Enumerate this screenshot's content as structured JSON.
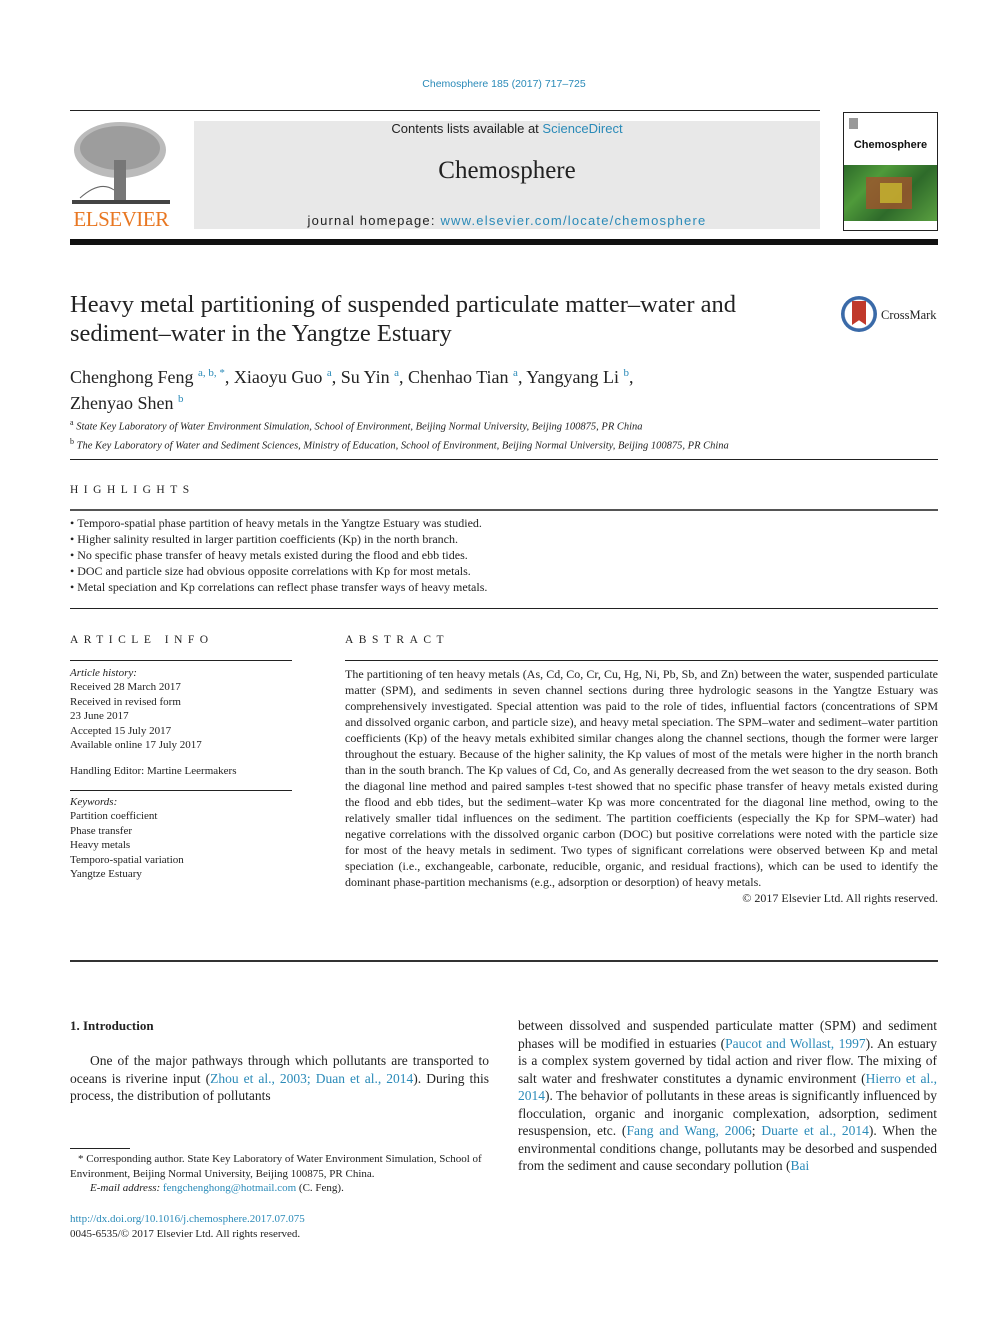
{
  "header": {
    "journal_ref": "Chemosphere 185 (2017) 717–725",
    "publisher": "ELSEVIER",
    "contents_prefix": "Contents lists available at ",
    "contents_link": "ScienceDirect",
    "journal_title": "Chemosphere",
    "homepage_prefix": "journal homepage: ",
    "homepage_link": "www.elsevier.com/locate/chemosphere",
    "cover_title": "Chemosphere"
  },
  "article": {
    "title": "Heavy metal partitioning of suspended particulate matter–water and sediment–water in the Yangtze Estuary",
    "crossmark": "CrossMark",
    "authors": [
      {
        "name": "Chenghong Feng",
        "sup": "a, b, *",
        "sep": ", "
      },
      {
        "name": "Xiaoyu Guo",
        "sup": "a",
        "sep": ", "
      },
      {
        "name": "Su Yin",
        "sup": "a",
        "sep": ", "
      },
      {
        "name": "Chenhao Tian",
        "sup": "a",
        "sep": ", "
      },
      {
        "name": "Yangyang Li",
        "sup": "b",
        "sep": ","
      },
      {
        "name": "Zhenyao Shen",
        "sup": "b",
        "sep": ""
      }
    ],
    "affiliations": [
      {
        "mark": "a",
        "text": "State Key Laboratory of Water Environment Simulation, School of Environment, Beijing Normal University, Beijing 100875, PR China"
      },
      {
        "mark": "b",
        "text": "The Key Laboratory of Water and Sediment Sciences, Ministry of Education, School of Environment, Beijing Normal University, Beijing 100875, PR China"
      }
    ]
  },
  "highlights": {
    "heading": "HIGHLIGHTS",
    "items": [
      "Temporo-spatial phase partition of heavy metals in the Yangtze Estuary was studied.",
      "Higher salinity resulted in larger partition coefficients (Kp) in the north branch.",
      "No specific phase transfer of heavy metals existed during the flood and ebb tides.",
      "DOC and particle size had obvious opposite correlations with Kp for most metals.",
      "Metal speciation and Kp correlations can reflect phase transfer ways of heavy metals."
    ]
  },
  "article_info": {
    "heading": "ARTICLE INFO",
    "history_label": "Article history:",
    "history": [
      "Received 28 March 2017",
      "Received in revised form",
      "23 June 2017",
      "Accepted 15 July 2017",
      "Available online 17 July 2017"
    ],
    "handling_editor": "Handling Editor: Martine Leermakers",
    "keywords_label": "Keywords:",
    "keywords": [
      "Partition coefficient",
      "Phase transfer",
      "Heavy metals",
      "Temporo-spatial variation",
      "Yangtze Estuary"
    ]
  },
  "abstract": {
    "heading": "ABSTRACT",
    "text": "The partitioning of ten heavy metals (As, Cd, Co, Cr, Cu, Hg, Ni, Pb, Sb, and Zn) between the water, suspended particulate matter (SPM), and sediments in seven channel sections during three hydrologic seasons in the Yangtze Estuary was comprehensively investigated. Special attention was paid to the role of tides, influential factors (concentrations of SPM and dissolved organic carbon, and particle size), and heavy metal speciation. The SPM–water and sediment–water partition coefficients (Kp) of the heavy metals exhibited similar changes along the channel sections, though the former were larger throughout the estuary. Because of the higher salinity, the Kp values of most of the metals were higher in the north branch than in the south branch. The Kp values of Cd, Co, and As generally decreased from the wet season to the dry season. Both the diagonal line method and paired samples t-test showed that no specific phase transfer of heavy metals existed during the flood and ebb tides, but the sediment–water Kp was more concentrated for the diagonal line method, owing to the relatively smaller tidal influences on the sediment. The partition coefficients (especially the Kp for SPM–water) had negative correlations with the dissolved organic carbon (DOC) but positive correlations were noted with the particle size for most of the heavy metals in sediment. Two types of significant correlations were observed between Kp and metal speciation (i.e., exchangeable, carbonate, reducible, organic, and residual fractions), which can be used to identify the dominant phase-partition mechanisms (e.g., adsorption or desorption) of heavy metals.",
    "copyright": "© 2017 Elsevier Ltd. All rights reserved."
  },
  "introduction": {
    "heading": "1.  Introduction",
    "col1": {
      "p1": "One of the major pathways through which pollutants are transported to oceans is riverine input (",
      "link1": "Zhou et al., 2003; Duan et al., 2014",
      "p2": "). During this process, the distribution of pollutants"
    },
    "col2": {
      "t1": "between dissolved and suspended particulate matter (SPM) and sediment phases will be modified in estuaries (",
      "l1": "Paucot and Wollast, 1997",
      "t2": "). An estuary is a complex system governed by tidal action and river flow. The mixing of salt water and freshwater constitutes a dynamic environment (",
      "l2": "Hierro et al., 2014",
      "t3": "). The behavior of pollutants in these areas is significantly influenced by flocculation, organic and inorganic complexation, adsorption, sediment resuspension, etc. (",
      "l3": "Fang and Wang, 2006",
      "t4": "; ",
      "l4": "Duarte et al., 2014",
      "t5": "). When the environmental conditions change, pollutants may be desorbed and suspended from the sediment and cause secondary pollution (",
      "l5": "Bai"
    }
  },
  "footnote": {
    "corresponding": "* Corresponding author. State Key Laboratory of Water Environment Simulation, School of Environment, Beijing Normal University, Beijing 100875, PR China.",
    "email_label": "E-mail address: ",
    "email": "fengchenghong@hotmail.com",
    "email_suffix": " (C. Feng).",
    "doi": "http://dx.doi.org/10.1016/j.chemosphere.2017.07.075",
    "issn": "0045-6535/© 2017 Elsevier Ltd. All rights reserved."
  }
}
